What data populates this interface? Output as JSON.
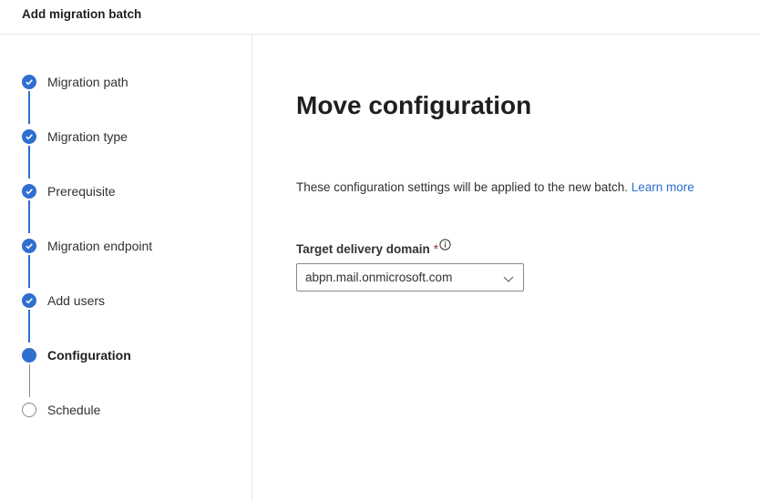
{
  "header": {
    "title": "Add migration batch"
  },
  "steps": [
    {
      "label": "Migration path",
      "state": "done"
    },
    {
      "label": "Migration type",
      "state": "done"
    },
    {
      "label": "Prerequisite",
      "state": "done"
    },
    {
      "label": "Migration endpoint",
      "state": "done"
    },
    {
      "label": "Add users",
      "state": "done"
    },
    {
      "label": "Configuration",
      "state": "current"
    },
    {
      "label": "Schedule",
      "state": "todo"
    }
  ],
  "main": {
    "title": "Move configuration",
    "description": "These configuration settings will be applied to the new batch. ",
    "learn_more": "Learn more",
    "field": {
      "label": "Target delivery domain",
      "required": "*",
      "value": "abpn.mail.onmicrosoft.com"
    }
  },
  "colors": {
    "accent": "#2f6fcf",
    "required": "#a4262c",
    "border": "#8a8886"
  },
  "icons": {
    "done": "checkmark-icon",
    "info": "info-icon",
    "dropdown": "chevron-down-icon"
  }
}
